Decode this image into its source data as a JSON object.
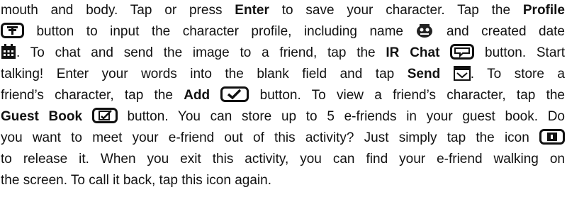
{
  "paragraph": {
    "l1": {
      "t1": "mouth and body.  Tap or press ",
      "b1": "Enter",
      "t2": " to save your character.  Tap the ",
      "b2": "Profile"
    },
    "l2": {
      "t1": " button to input the character profile, including name ",
      "t2": " and created date"
    },
    "l3": {
      "t1": ".  To chat and send the image to a friend, tap the ",
      "b1": "IR Chat",
      "t2": " button.  Start"
    },
    "l4": {
      "t1": "talking!  Enter your words into the blank field and tap ",
      "b1": "Send",
      "t2": ".  To store a"
    },
    "l5": {
      "t1": "friend’s character, tap the ",
      "b1": "Add",
      "t2": " button.  To view a friend’s character, tap the"
    },
    "l6": {
      "b1": "Guest Book",
      "t1": " button. You can store up to 5 e-friends in your guest book.  Do"
    },
    "l7": {
      "t1": "you want to meet your e-friend out of this activity?  Just simply tap the icon"
    },
    "l8": {
      "t1": "to release it.  When you exit this activity, you can find your e-friend walking on"
    },
    "l9": {
      "t1": "the screen.  To call it back, tap this icon again."
    }
  },
  "icons": [
    "profile-icon",
    "name-icon",
    "date-icon",
    "ir-chat-icon",
    "send-icon",
    "add-icon",
    "guest-book-icon",
    "release-icon"
  ]
}
